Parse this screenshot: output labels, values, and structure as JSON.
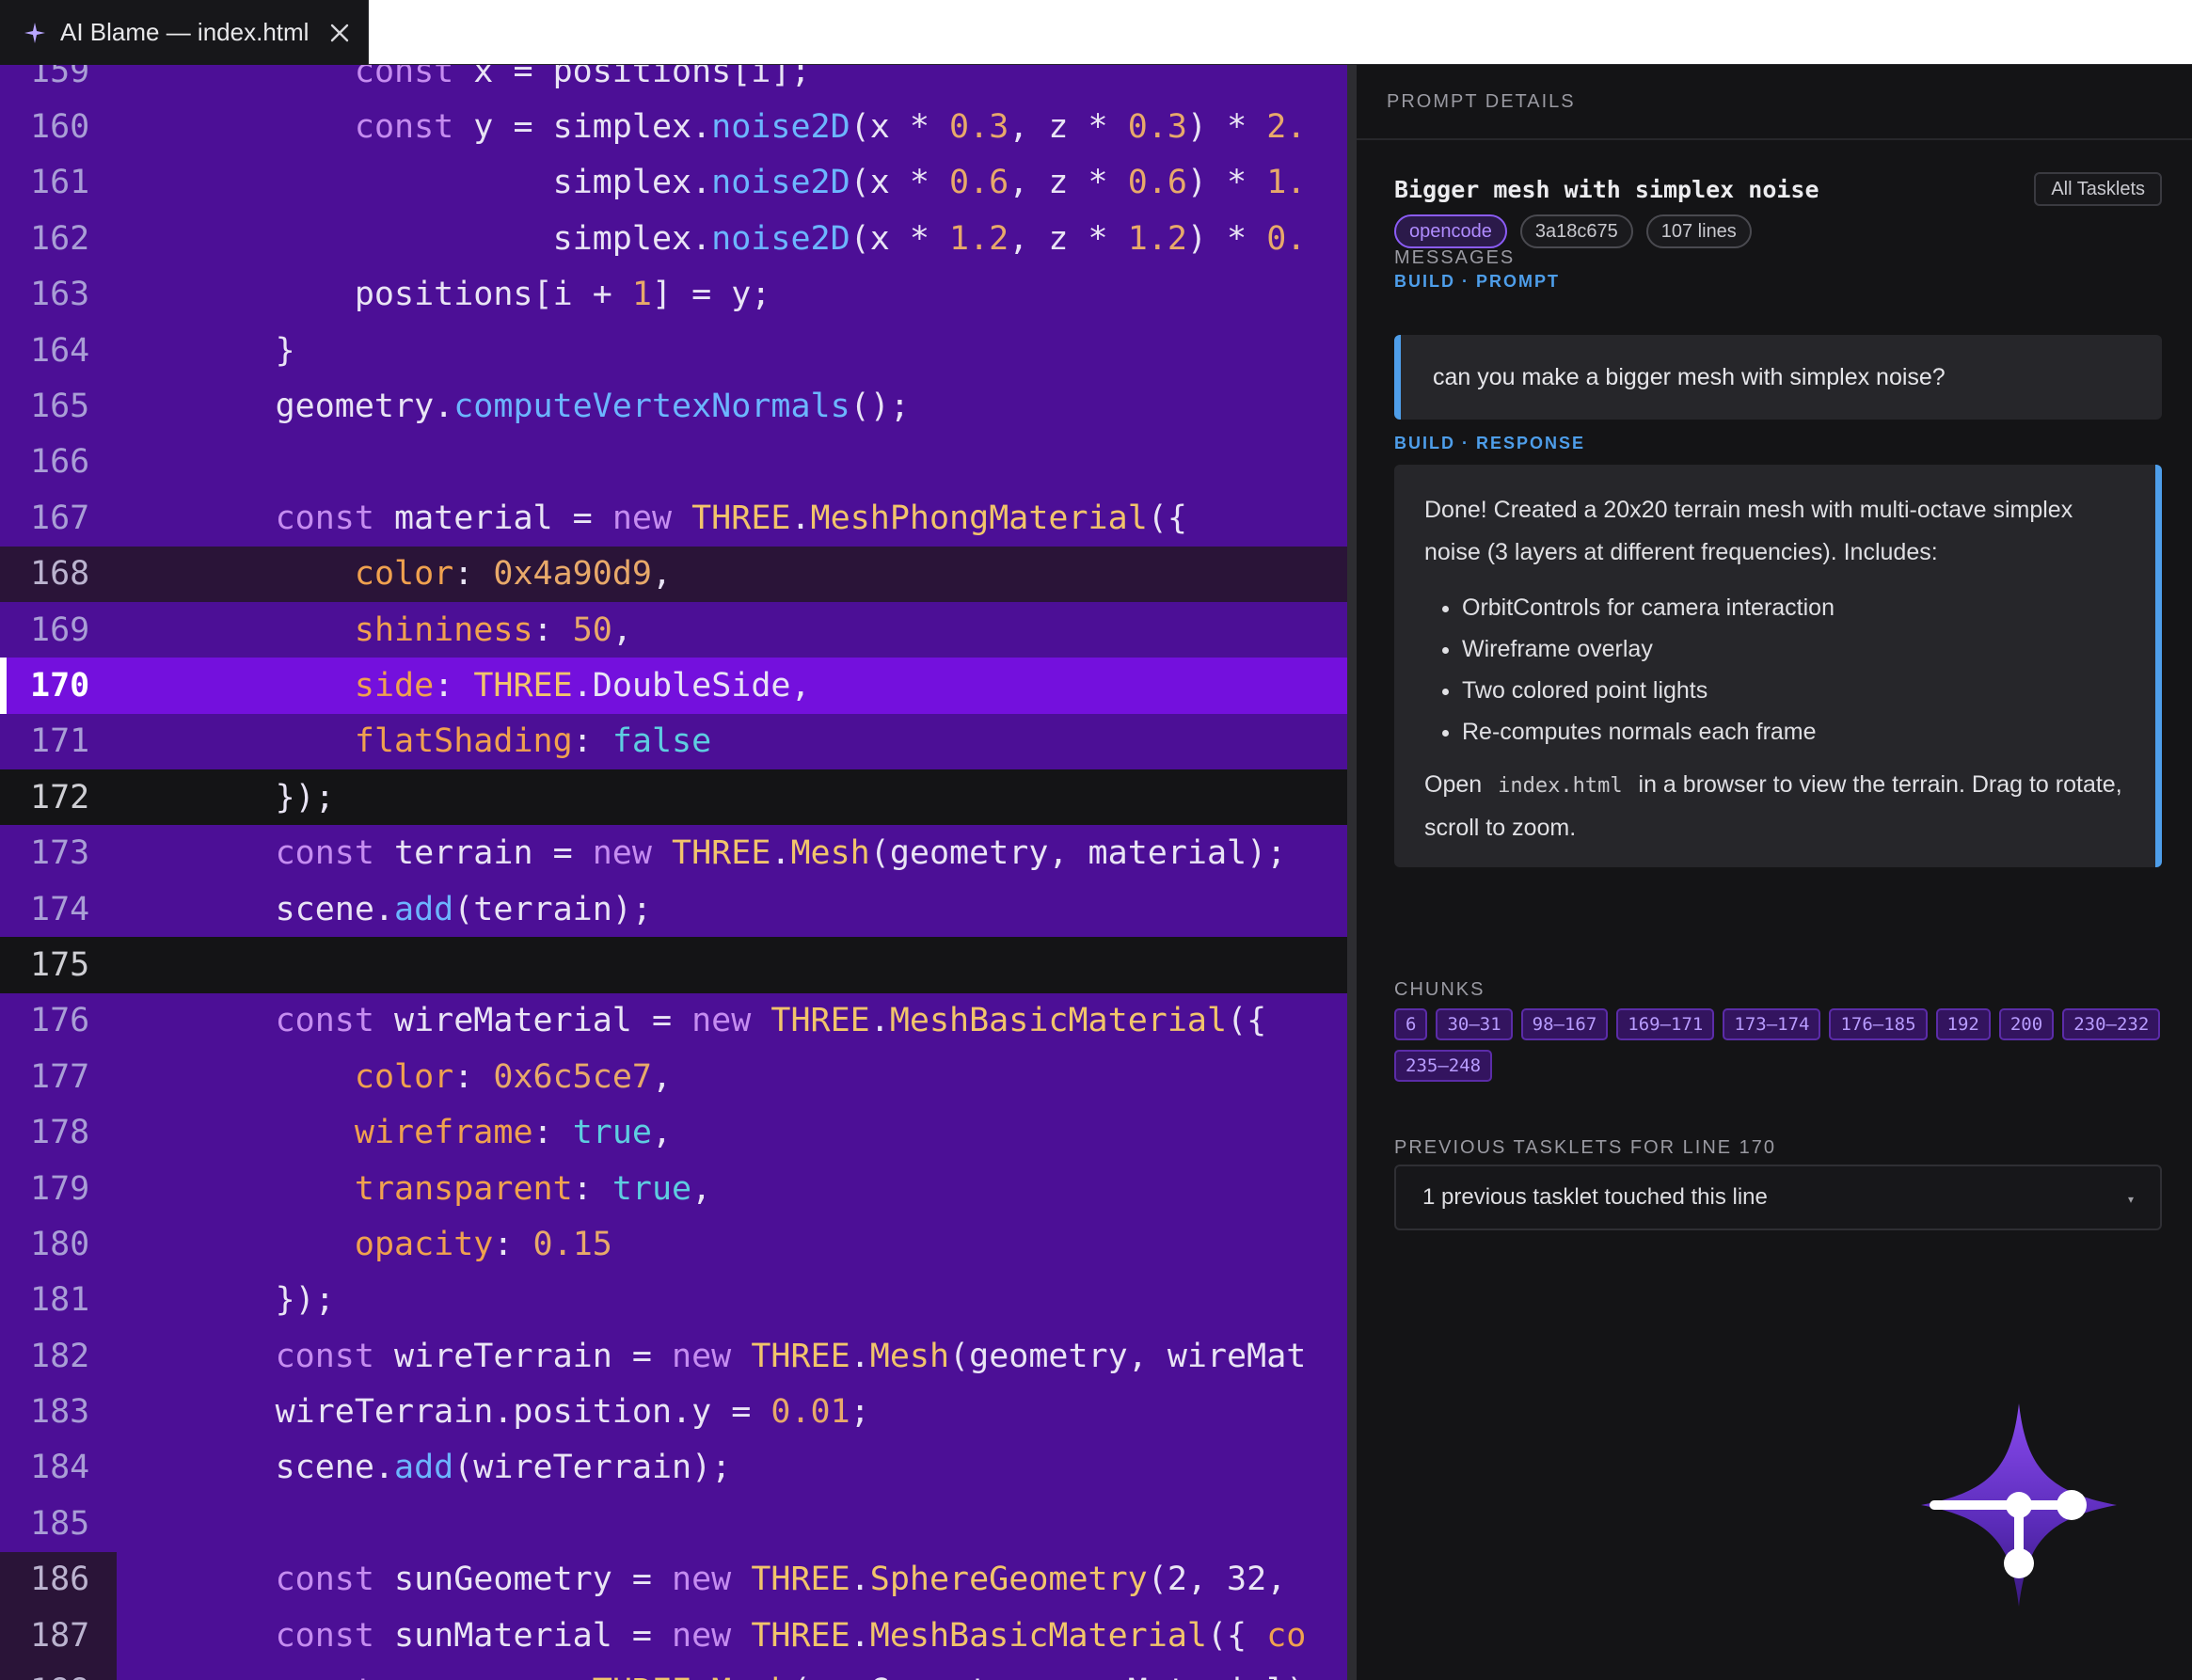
{
  "tab": {
    "title": "AI Blame — index.html",
    "icon": "sparkle-icon",
    "close_icon": "close-icon"
  },
  "editor": {
    "lines": [
      {
        "n": "159",
        "t": "u",
        "segs": [
          [
            "t",
            "            "
          ],
          [
            "k",
            "const"
          ],
          [
            "t",
            " x = positions[i];"
          ]
        ]
      },
      {
        "n": "160",
        "t": "u",
        "segs": [
          [
            "t",
            "            "
          ],
          [
            "k",
            "const"
          ],
          [
            "t",
            " y = simplex."
          ],
          [
            "f",
            "noise2D"
          ],
          [
            "t",
            "(x * "
          ],
          [
            "n",
            "0.3"
          ],
          [
            "t",
            ", z * "
          ],
          [
            "n",
            "0.3"
          ],
          [
            "t",
            ") * "
          ],
          [
            "n",
            "2."
          ]
        ]
      },
      {
        "n": "161",
        "t": "u",
        "segs": [
          [
            "t",
            "                      simplex."
          ],
          [
            "f",
            "noise2D"
          ],
          [
            "t",
            "(x * "
          ],
          [
            "n",
            "0.6"
          ],
          [
            "t",
            ", z * "
          ],
          [
            "n",
            "0.6"
          ],
          [
            "t",
            ") * "
          ],
          [
            "n",
            "1."
          ]
        ]
      },
      {
        "n": "162",
        "t": "u",
        "segs": [
          [
            "t",
            "                      simplex."
          ],
          [
            "f",
            "noise2D"
          ],
          [
            "t",
            "(x * "
          ],
          [
            "n",
            "1.2"
          ],
          [
            "t",
            ", z * "
          ],
          [
            "n",
            "1.2"
          ],
          [
            "t",
            ") * "
          ],
          [
            "n",
            "0."
          ]
        ]
      },
      {
        "n": "163",
        "t": "u",
        "segs": [
          [
            "t",
            "            positions[i + "
          ],
          [
            "n",
            "1"
          ],
          [
            "t",
            "] = y;"
          ]
        ]
      },
      {
        "n": "164",
        "t": "u",
        "segs": [
          [
            "t",
            "        }"
          ]
        ]
      },
      {
        "n": "165",
        "t": "u",
        "segs": [
          [
            "t",
            "        geometry."
          ],
          [
            "f",
            "computeVertexNormals"
          ],
          [
            "t",
            "();"
          ]
        ]
      },
      {
        "n": "166",
        "t": "u",
        "segs": [
          [
            "t",
            ""
          ]
        ]
      },
      {
        "n": "167",
        "t": "u",
        "segs": [
          [
            "t",
            "        "
          ],
          [
            "k",
            "const"
          ],
          [
            "t",
            " material = "
          ],
          [
            "k",
            "new"
          ],
          [
            "t",
            " "
          ],
          [
            "c",
            "THREE"
          ],
          [
            "t",
            "."
          ],
          [
            "c",
            "MeshPhongMaterial"
          ],
          [
            "t",
            "({"
          ]
        ]
      },
      {
        "n": "168",
        "t": "d",
        "segs": [
          [
            "t",
            "            "
          ],
          [
            "p",
            "color"
          ],
          [
            "t",
            ": "
          ],
          [
            "n",
            "0x4a90d9"
          ],
          [
            "t",
            ","
          ]
        ]
      },
      {
        "n": "169",
        "t": "u",
        "segs": [
          [
            "t",
            "            "
          ],
          [
            "p",
            "shininess"
          ],
          [
            "t",
            ": "
          ],
          [
            "n",
            "50"
          ],
          [
            "t",
            ","
          ]
        ]
      },
      {
        "n": "170",
        "t": "cur",
        "segs": [
          [
            "t",
            "            "
          ],
          [
            "p",
            "side"
          ],
          [
            "t",
            ": "
          ],
          [
            "c",
            "THREE"
          ],
          [
            "t",
            ".DoubleSide,"
          ]
        ]
      },
      {
        "n": "171",
        "t": "u",
        "segs": [
          [
            "t",
            "            "
          ],
          [
            "p",
            "flatShading"
          ],
          [
            "t",
            ": "
          ],
          [
            "b",
            "false"
          ]
        ]
      },
      {
        "n": "172",
        "t": "b",
        "segs": [
          [
            "t",
            "        });"
          ]
        ]
      },
      {
        "n": "173",
        "t": "u",
        "segs": [
          [
            "t",
            "        "
          ],
          [
            "k",
            "const"
          ],
          [
            "t",
            " terrain = "
          ],
          [
            "k",
            "new"
          ],
          [
            "t",
            " "
          ],
          [
            "c",
            "THREE"
          ],
          [
            "t",
            "."
          ],
          [
            "c",
            "Mesh"
          ],
          [
            "t",
            "(geometry, material);"
          ]
        ]
      },
      {
        "n": "174",
        "t": "u",
        "segs": [
          [
            "t",
            "        scene."
          ],
          [
            "f",
            "add"
          ],
          [
            "t",
            "(terrain);"
          ]
        ]
      },
      {
        "n": "175",
        "t": "b",
        "segs": [
          [
            "t",
            ""
          ]
        ]
      },
      {
        "n": "176",
        "t": "u",
        "segs": [
          [
            "t",
            "        "
          ],
          [
            "k",
            "const"
          ],
          [
            "t",
            " wireMaterial = "
          ],
          [
            "k",
            "new"
          ],
          [
            "t",
            " "
          ],
          [
            "c",
            "THREE"
          ],
          [
            "t",
            "."
          ],
          [
            "c",
            "MeshBasicMaterial"
          ],
          [
            "t",
            "({"
          ]
        ]
      },
      {
        "n": "177",
        "t": "u",
        "segs": [
          [
            "t",
            "            "
          ],
          [
            "p",
            "color"
          ],
          [
            "t",
            ": "
          ],
          [
            "n",
            "0x6c5ce7"
          ],
          [
            "t",
            ","
          ]
        ]
      },
      {
        "n": "178",
        "t": "u",
        "segs": [
          [
            "t",
            "            "
          ],
          [
            "p",
            "wireframe"
          ],
          [
            "t",
            ": "
          ],
          [
            "b",
            "true"
          ],
          [
            "t",
            ","
          ]
        ]
      },
      {
        "n": "179",
        "t": "u",
        "segs": [
          [
            "t",
            "            "
          ],
          [
            "p",
            "transparent"
          ],
          [
            "t",
            ": "
          ],
          [
            "b",
            "true"
          ],
          [
            "t",
            ","
          ]
        ]
      },
      {
        "n": "180",
        "t": "u",
        "segs": [
          [
            "t",
            "            "
          ],
          [
            "p",
            "opacity"
          ],
          [
            "t",
            ": "
          ],
          [
            "n",
            "0.15"
          ]
        ]
      },
      {
        "n": "181",
        "t": "u",
        "segs": [
          [
            "t",
            "        });"
          ]
        ]
      },
      {
        "n": "182",
        "t": "u",
        "segs": [
          [
            "t",
            "        "
          ],
          [
            "k",
            "const"
          ],
          [
            "t",
            " wireTerrain = "
          ],
          [
            "k",
            "new"
          ],
          [
            "t",
            " "
          ],
          [
            "c",
            "THREE"
          ],
          [
            "t",
            "."
          ],
          [
            "c",
            "Mesh"
          ],
          [
            "t",
            "(geometry, wireMat"
          ]
        ]
      },
      {
        "n": "183",
        "t": "u",
        "segs": [
          [
            "t",
            "        wireTerrain.position.y = "
          ],
          [
            "n",
            "0.01"
          ],
          [
            "t",
            ";"
          ]
        ]
      },
      {
        "n": "184",
        "t": "u",
        "segs": [
          [
            "t",
            "        scene."
          ],
          [
            "f",
            "add"
          ],
          [
            "t",
            "(wireTerrain);"
          ]
        ]
      },
      {
        "n": "185",
        "t": "u",
        "segs": [
          [
            "t",
            ""
          ]
        ]
      },
      {
        "n": "186",
        "t": "m",
        "segs": [
          [
            "t",
            "        "
          ],
          [
            "k",
            "const"
          ],
          [
            "t",
            " sunGeometry = "
          ],
          [
            "k",
            "new"
          ],
          [
            "t",
            " "
          ],
          [
            "c",
            "THREE"
          ],
          [
            "t",
            "."
          ],
          [
            "c",
            "SphereGeometry"
          ],
          [
            "t",
            "(2, 32,"
          ]
        ]
      },
      {
        "n": "187",
        "t": "m",
        "segs": [
          [
            "t",
            "        "
          ],
          [
            "k",
            "const"
          ],
          [
            "t",
            " sunMaterial = "
          ],
          [
            "k",
            "new"
          ],
          [
            "t",
            " "
          ],
          [
            "c",
            "THREE"
          ],
          [
            "t",
            "."
          ],
          [
            "c",
            "MeshBasicMaterial"
          ],
          [
            "t",
            "({ "
          ],
          [
            "p",
            "co"
          ]
        ]
      },
      {
        "n": "188",
        "t": "m",
        "segs": [
          [
            "t",
            "        "
          ],
          [
            "k",
            "const"
          ],
          [
            "t",
            " sun = "
          ],
          [
            "k",
            "new"
          ],
          [
            "t",
            " "
          ],
          [
            "c",
            "THREE"
          ],
          [
            "t",
            "."
          ],
          [
            "c",
            "Mesh"
          ],
          [
            "t",
            "(sunGeometry, sunMaterial)"
          ]
        ]
      }
    ]
  },
  "panel": {
    "header": "PROMPT DETAILS",
    "title": "Bigger mesh with simplex noise",
    "all_tasklets": "All Tasklets",
    "badges": {
      "agent": "opencode",
      "hash": "3a18c675",
      "lines": "107 lines"
    },
    "messages_label": "MESSAGES",
    "prompt_label": {
      "kind": "BUILD",
      "sep": " · ",
      "role": "PROMPT"
    },
    "prompt_text": "can you make a bigger mesh with simplex noise?",
    "response_label": {
      "kind": "BUILD",
      "sep": " · ",
      "role": "RESPONSE"
    },
    "response": {
      "intro": "Done! Created a 20x20 terrain mesh with multi-octave simplex noise (3 layers at different frequencies). Includes:",
      "bullets": [
        "OrbitControls for camera interaction",
        "Wireframe overlay",
        "Two colored point lights",
        "Re-computes normals each frame"
      ],
      "outro_pre": "Open",
      "outro_code": "index.html",
      "outro_post": "in a browser to view the terrain. Drag to rotate, scroll to zoom."
    },
    "chunks_label": "CHUNKS",
    "chunks": [
      "6",
      "30–31",
      "98–167",
      "169–171",
      "173–174",
      "176–185",
      "192",
      "200",
      "230–232",
      "235–248"
    ],
    "previous_label": "PREVIOUS TASKLETS FOR LINE 170",
    "previous_select": "1 previous tasklet touched this line",
    "logo_icon": "ai-blame-logo-icon"
  },
  "colors": {
    "accent": "#4e9eea",
    "purple_line": "#4c0f96",
    "current_line": "#7410dd",
    "panel_bg": "#141416"
  }
}
